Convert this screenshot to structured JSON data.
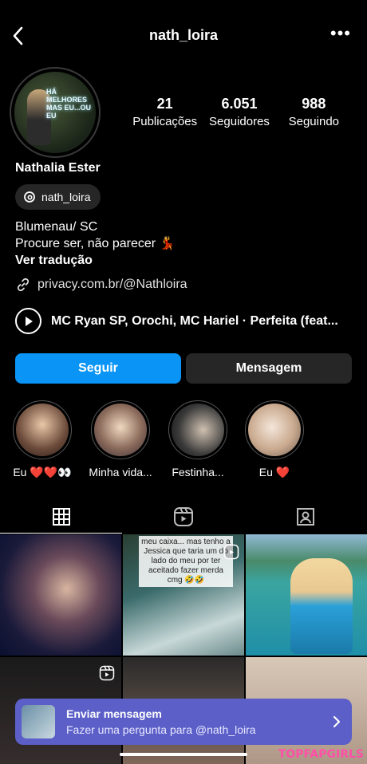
{
  "header": {
    "username": "nath_loira",
    "more": "•••"
  },
  "profile": {
    "stats": [
      {
        "value": "21",
        "label": "Publicações"
      },
      {
        "value": "6.051",
        "label": "Seguidores"
      },
      {
        "value": "988",
        "label": "Seguindo"
      }
    ],
    "name": "Nathalia Ester",
    "threads_handle": "nath_loira",
    "bio_line1": "Blumenau/ SC",
    "bio_line2": "Procure ser, não parecer 💃",
    "translate": "Ver tradução",
    "link": "privacy.com.br/@Nathloira",
    "music": "MC Ryan SP, Orochi, MC Hariel · Perfeita (feat..."
  },
  "buttons": {
    "follow": "Seguir",
    "message": "Mensagem"
  },
  "highlights": [
    {
      "label": "Eu ❤️❤️👀"
    },
    {
      "label": "Minha vida..."
    },
    {
      "label": "Festinha..."
    },
    {
      "label": "Eu ❤️"
    }
  ],
  "grid": {
    "post2_caption": "meu caixa... mas tenho a Jessica que taria um do lado do meu por ter aceitado fazer merda cmg 🤣🤣"
  },
  "banner": {
    "title": "Enviar mensagem",
    "subtitle": "Fazer uma pergunta para @nath_loira"
  },
  "watermark": "TOPFAPGIRLS",
  "colors": {
    "accent": "#0a95f6",
    "banner": "#5b5fc7",
    "pill": "#262626"
  }
}
